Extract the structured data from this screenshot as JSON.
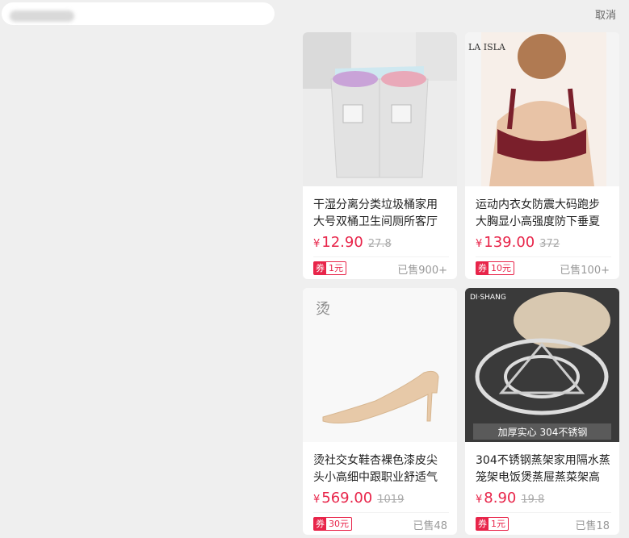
{
  "header": {
    "cancel_label": "取消"
  },
  "products": [
    {
      "title_line1": "干湿分离分类垃圾桶家用",
      "title_line2": "大号双桶卫生间厕所客厅",
      "price": "12.90",
      "original_price": "27.8",
      "coupon_label": "券",
      "coupon_amount": "1元",
      "sold": "已售900+"
    },
    {
      "image_text": "LA ISLA",
      "title_line1": "运动内衣女防震大码跑步",
      "title_line2": "大胸显小高强度防下垂夏",
      "price": "139.00",
      "original_price": "372",
      "coupon_label": "券",
      "coupon_amount": "10元",
      "sold": "已售100+"
    },
    {
      "title_line1": "烫社交女鞋杏裸色漆皮尖",
      "title_line2": "头小高细中跟职业舒适气",
      "price": "569.00",
      "original_price": "1019",
      "coupon_label": "券",
      "coupon_amount": "30元",
      "sold": "已售48"
    },
    {
      "image_text": "DI·SHANG",
      "image_banner": "加厚实心  304不锈钢",
      "title_line1": "304不锈钢蒸架家用隔水蒸",
      "title_line2": "笼架电饭煲蒸屉蒸菜架高",
      "price": "8.90",
      "original_price": "19.8",
      "coupon_label": "券",
      "coupon_amount": "1元",
      "sold": "已售18"
    }
  ],
  "currency_symbol": "¥",
  "colors": {
    "accent": "#e8254a",
    "background": "#efefef"
  }
}
